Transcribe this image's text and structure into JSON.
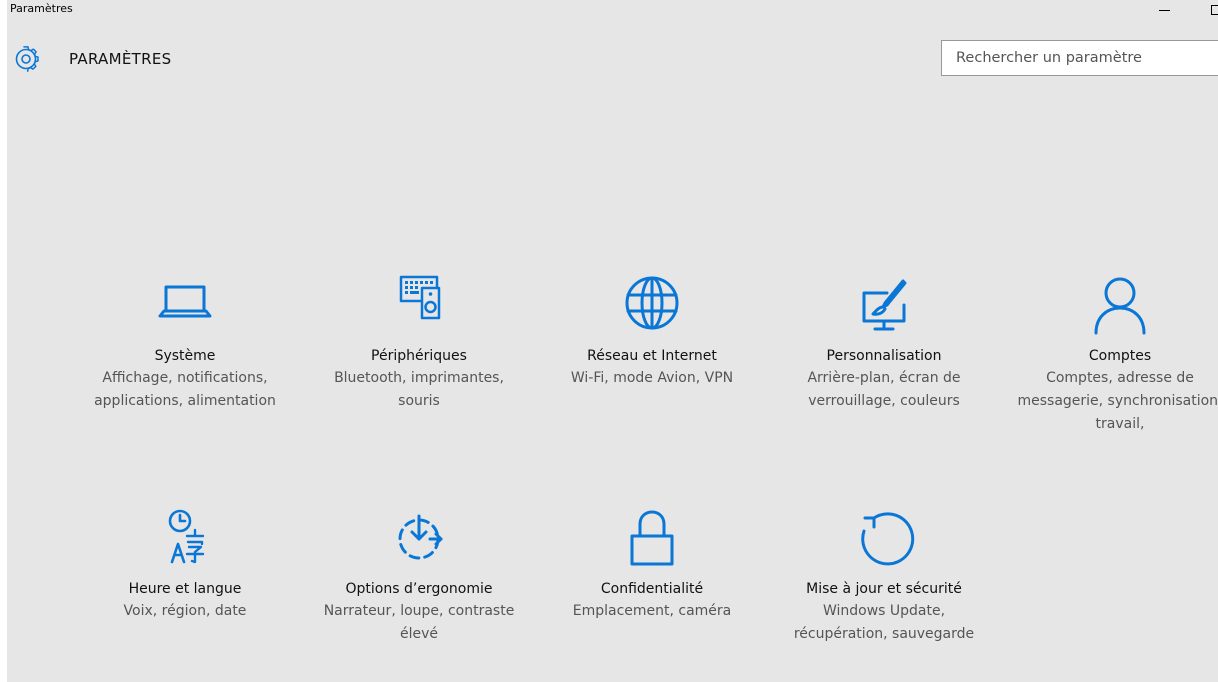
{
  "window": {
    "title": "Paramètres"
  },
  "header": {
    "title": "PARAMÈTRES",
    "icon": "gear-icon"
  },
  "search": {
    "placeholder": "Rechercher un paramètre"
  },
  "colors": {
    "accent": "#0a76d6",
    "background": "#e6e6e6"
  },
  "tiles": [
    {
      "label": "Système",
      "desc": "Affichage, notifications, applications, alimentation",
      "icon": "laptop-icon"
    },
    {
      "label": "Périphériques",
      "desc": "Bluetooth, imprimantes, souris",
      "icon": "devices-icon"
    },
    {
      "label": "Réseau et Internet",
      "desc": "Wi-Fi, mode Avion, VPN",
      "icon": "globe-icon"
    },
    {
      "label": "Personnalisation",
      "desc": "Arrière-plan, écran de verrouillage, couleurs",
      "icon": "paint-icon"
    },
    {
      "label": "Comptes",
      "desc": "Comptes, adresse de messagerie, synchronisation, travail,",
      "icon": "person-icon"
    },
    {
      "label": "Heure et langue",
      "desc": "Voix, région, date",
      "icon": "time-language-icon"
    },
    {
      "label": "Options d’ergonomie",
      "desc": "Narrateur, loupe, contraste élevé",
      "icon": "ease-of-access-icon"
    },
    {
      "label": "Confidentialité",
      "desc": "Emplacement, caméra",
      "icon": "lock-icon"
    },
    {
      "label": "Mise à jour et sécurité",
      "desc": "Windows Update, récupération, sauvegarde",
      "icon": "update-icon"
    }
  ]
}
